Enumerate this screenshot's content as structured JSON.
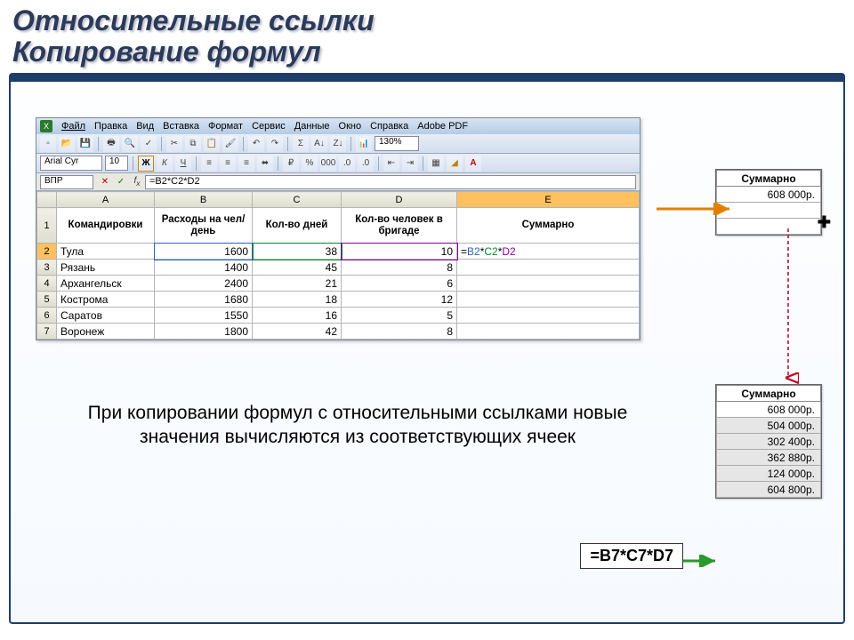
{
  "title_line1": "Относительные ссылки",
  "title_line2": "Копирование формул",
  "menu": {
    "file": "Файл",
    "edit": "Правка",
    "view": "Вид",
    "insert": "Вставка",
    "format": "Формат",
    "tools": "Сервис",
    "data": "Данные",
    "window": "Окно",
    "help": "Справка",
    "adobe": "Adobe PDF"
  },
  "format_bar": {
    "font_name": "Arial Cyr",
    "font_size": "10",
    "bold_label": "Ж",
    "italic_label": "К",
    "underline_label": "Ч"
  },
  "toolbar": {
    "zoom": "130%",
    "sigma": "Σ"
  },
  "formula_bar": {
    "name_box": "ВПР",
    "formula": "=B2*C2*D2"
  },
  "grid": {
    "col_labels": [
      "A",
      "B",
      "C",
      "D",
      "E"
    ],
    "header_row": "1",
    "headers": {
      "A": "Командировки",
      "B": "Расходы на чел/день",
      "C": "Кол-во дней",
      "D": "Кол-во человек в бригаде",
      "E": "Суммарно"
    },
    "rows": [
      {
        "n": "2",
        "A": "Тула",
        "B": "1600",
        "C": "38",
        "D": "10",
        "E": "=B2*C2*D2"
      },
      {
        "n": "3",
        "A": "Рязань",
        "B": "1400",
        "C": "45",
        "D": "8",
        "E": ""
      },
      {
        "n": "4",
        "A": "Архангельск",
        "B": "2400",
        "C": "21",
        "D": "6",
        "E": ""
      },
      {
        "n": "5",
        "A": "Кострома",
        "B": "1680",
        "C": "18",
        "D": "12",
        "E": ""
      },
      {
        "n": "6",
        "A": "Саратов",
        "B": "1550",
        "C": "16",
        "D": "5",
        "E": ""
      },
      {
        "n": "7",
        "A": "Воронеж",
        "B": "1800",
        "C": "42",
        "D": "8",
        "E": ""
      }
    ]
  },
  "right_box_1": {
    "header": "Суммарно",
    "value": "608 000р."
  },
  "right_box_2": {
    "header": "Суммарно",
    "values": [
      "608 000р.",
      "504 000р.",
      "302 400р.",
      "362 880р.",
      "124 000р.",
      "604 800р."
    ]
  },
  "caption": "При копировании формул с относительными ссылками новые значения вычисляются из соответствующих ячеек",
  "callout_formula": "=B7*C7*D7"
}
